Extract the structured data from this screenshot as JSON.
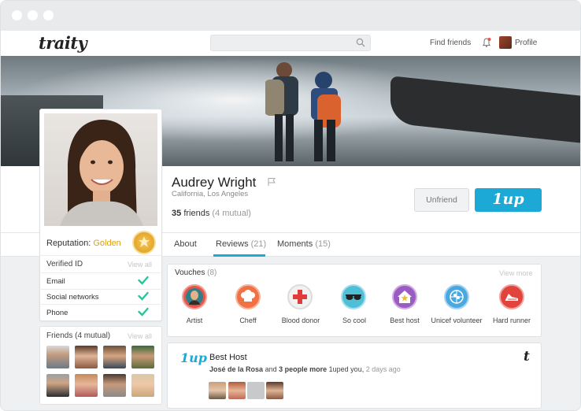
{
  "app": {
    "logo": "traity"
  },
  "header": {
    "search": {
      "placeholder": ""
    },
    "find_friends": "Find friends",
    "profile": "Profile"
  },
  "profile": {
    "name": "Audrey Wright",
    "location": "California, Los Angeles",
    "friends_count": "35",
    "friends_word": "friends",
    "mutual": "(4 mutual)",
    "unfriend_label": "Unfriend",
    "oneup_label": "1up"
  },
  "tabs": [
    {
      "label": "About",
      "count": ""
    },
    {
      "label": "Reviews",
      "count": "(21)"
    },
    {
      "label": "Moments",
      "count": "(15)"
    }
  ],
  "sidebar": {
    "reputation_label": "Reputation:",
    "reputation_value": "Golden",
    "verified_title": "Verified ID",
    "view_all": "View all",
    "verifications": [
      {
        "label": "Email",
        "verified": true
      },
      {
        "label": "Social networks",
        "verified": true
      },
      {
        "label": "Phone",
        "verified": true
      }
    ],
    "friends_title": "Friends (4 mutual)",
    "friends_view_all": "View all"
  },
  "vouches": {
    "title": "Vouches",
    "count": "(8)",
    "view_more": "View more",
    "items": [
      {
        "label": "Artist",
        "icon": "mona-lisa-icon",
        "color": "#e8564a"
      },
      {
        "label": "Cheff",
        "icon": "chef-hat-icon",
        "color": "#f07143"
      },
      {
        "label": "Blood donor",
        "icon": "medical-cross-icon",
        "color": "#e8e8e8"
      },
      {
        "label": "So cool",
        "icon": "sunglasses-icon",
        "color": "#4fbfd8"
      },
      {
        "label": "Best host",
        "icon": "house-star-icon",
        "color": "#9a5bc2"
      },
      {
        "label": "Unicef volunteer",
        "icon": "unicef-icon",
        "color": "#4aa8e0"
      },
      {
        "label": "Hard runner",
        "icon": "running-shoe-icon",
        "color": "#e0443c"
      }
    ]
  },
  "review": {
    "logo": "1up",
    "title": "Best Host",
    "author": "José de la Rosa",
    "and_text": "and",
    "more": "3 people more",
    "action": "1uped you,",
    "time": "2 days ago",
    "brand_mark": "t"
  },
  "colors": {
    "accent": "#1da9d6",
    "golden": "#d9a219",
    "check": "#2bc49a"
  }
}
